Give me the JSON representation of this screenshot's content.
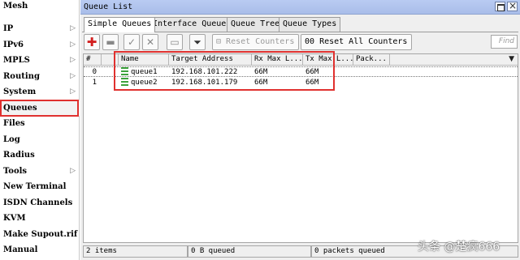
{
  "sidebar": {
    "items": [
      {
        "label": "Mesh",
        "has_submenu": false
      },
      {
        "label": "IP",
        "has_submenu": true
      },
      {
        "label": "IPv6",
        "has_submenu": true
      },
      {
        "label": "MPLS",
        "has_submenu": true
      },
      {
        "label": "Routing",
        "has_submenu": true
      },
      {
        "label": "System",
        "has_submenu": true
      },
      {
        "label": "Queues",
        "has_submenu": false,
        "selected": true
      },
      {
        "label": "Files",
        "has_submenu": false
      },
      {
        "label": "Log",
        "has_submenu": false
      },
      {
        "label": "Radius",
        "has_submenu": false
      },
      {
        "label": "Tools",
        "has_submenu": true
      },
      {
        "label": "New Terminal",
        "has_submenu": false
      },
      {
        "label": "ISDN Channels",
        "has_submenu": false
      },
      {
        "label": "KVM",
        "has_submenu": false
      },
      {
        "label": "Make Supout.rif",
        "has_submenu": false
      },
      {
        "label": "Manual",
        "has_submenu": false
      }
    ],
    "submenu_arrow": "▷"
  },
  "window": {
    "title": "Queue List",
    "maximize_icon": "maximize-icon",
    "close_icon": "close-icon"
  },
  "tabs": [
    {
      "label": "Simple Queues",
      "active": true
    },
    {
      "label": "Interface Queues",
      "active": false
    },
    {
      "label": "Queue Tree",
      "active": false
    },
    {
      "label": "Queue Types",
      "active": false
    }
  ],
  "toolbar": {
    "add_icon": "plus-icon",
    "remove_icon": "minus-icon",
    "enable_icon": "check-icon",
    "disable_icon": "x-icon",
    "comment_icon": "note-icon",
    "filter_icon": "filter-icon",
    "reset_counters_label": "Reset Counters",
    "reset_all_counters_label": "Reset All Counters",
    "find_placeholder": "Find"
  },
  "table": {
    "columns": [
      "#",
      "Name",
      "Target Address",
      "Rx Max L...",
      "Tx Max L...",
      "Pack..."
    ],
    "sort_arrow": "▼",
    "rows": [
      {
        "index": "0",
        "name": "queue1",
        "target": "192.168.101.222",
        "rx_max": "66M",
        "tx_max": "66M",
        "packets": ""
      },
      {
        "index": "1",
        "name": "queue2",
        "target": "192.168.101.179",
        "rx_max": "66M",
        "tx_max": "66M",
        "packets": ""
      }
    ]
  },
  "status": {
    "items": "2 items",
    "queued_bytes": "0 B queued",
    "queued_packets": "0 packets queued"
  },
  "watermark": "头条 @楚疯666",
  "colors": {
    "highlight": "#e0312f",
    "title_bar": "#b0c4ee",
    "queue_icon": "#3da33d",
    "add_button": "#d21f1f"
  }
}
